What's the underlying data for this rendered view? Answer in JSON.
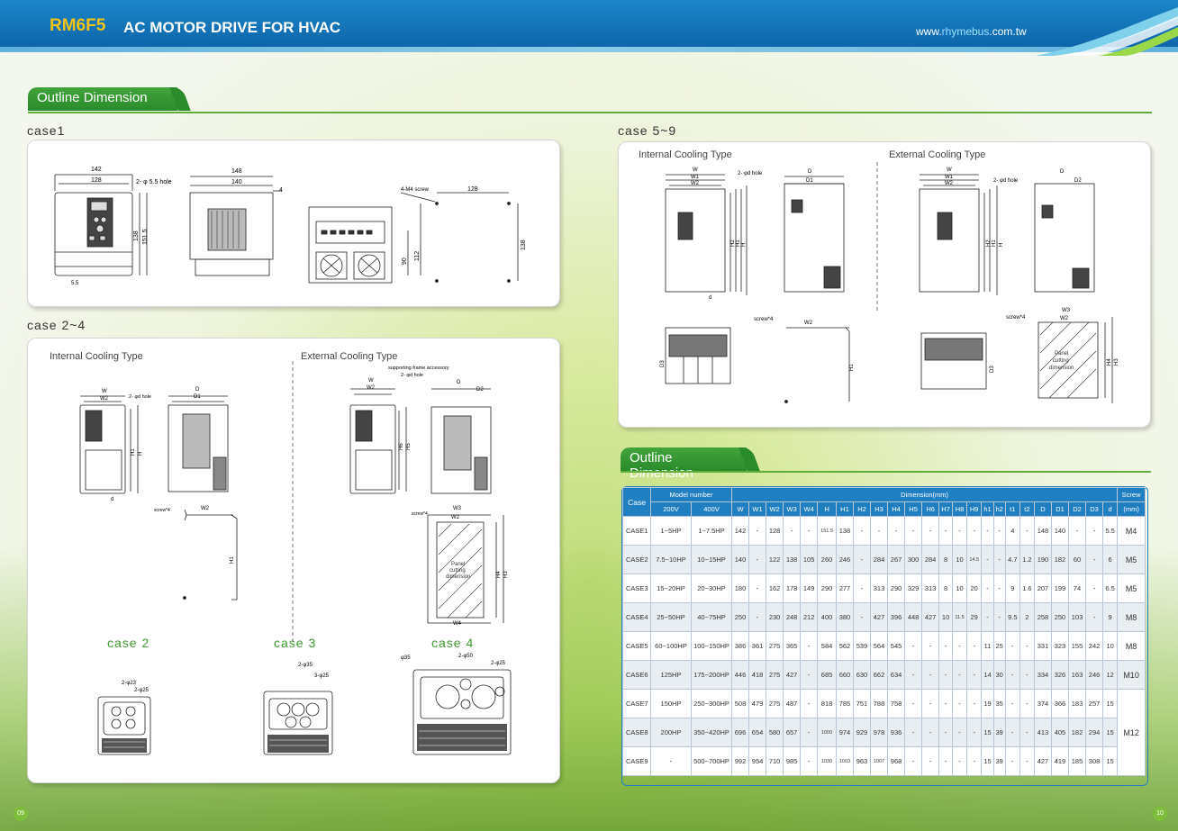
{
  "header": {
    "brand": "RM6F5",
    "subtitle": "AC MOTOR DRIVE FOR HVAC",
    "url_pre": "www.",
    "url_hl": "rhymebus",
    "url_post": ".com.tw"
  },
  "section_title": "Outline Dimension",
  "table_title": "Outline Dimension",
  "case1": {
    "label": "case1",
    "d142": "142",
    "d128": "128",
    "hole": "2- φ 5.5 hole",
    "d148": "148",
    "d140": "140",
    "d4": "4",
    "screw": "4-M4 screw",
    "d128b": "128",
    "d138": "138",
    "d90": "90",
    "d112": "112",
    "d5_5": "5.5",
    "d138b": "138",
    "d151_5": "151.5"
  },
  "case24": {
    "label": "case 2~4",
    "internal": "Internal Cooling Type",
    "external": "External Cooling Type",
    "support": "supporting frame accessory",
    "adhole": "2- φd hole",
    "screw": "screw*4",
    "panel": [
      "Panel",
      "cutting",
      "dimension"
    ],
    "case2": "case 2",
    "case3": "case 3",
    "case4": "case 4",
    "c2a": "2-φ23",
    "c2b": "2-φ25",
    "c3a": "2-φ35",
    "c3b": "3-φ25",
    "c4a": "φ35",
    "c4b": "2-φ50",
    "c4c": "2-φ25",
    "W": "W",
    "W1": "W1",
    "W2": "W2",
    "W3": "W3",
    "W4": "W4",
    "D": "D",
    "D1": "D1",
    "D2": "D2",
    "H": "H",
    "H1": "H1",
    "H3": "H3",
    "H4": "H4",
    "H5": "H5",
    "H6": "H6",
    "d": "d",
    "t1": "t1",
    "t2": "t2",
    "h1": "h1",
    "h2": "h2"
  },
  "case59": {
    "label": "case 5~9",
    "internal": "Internal Cooling Type",
    "external": "External Cooling Type",
    "adhole": "2- φd hole",
    "screw": "screw*4",
    "panel": [
      "Panel",
      "cutting",
      "dimension"
    ],
    "W": "W",
    "W1": "W1",
    "W2": "W2",
    "W3": "W3",
    "D": "D",
    "D1": "D1",
    "D2": "D2",
    "D3": "D3",
    "H": "H",
    "H1": "H1",
    "H2": "H2",
    "H3": "H3",
    "H4": "H4",
    "h1": "h1",
    "h2": "h2",
    "d": "d"
  },
  "table": {
    "col_case": "Case",
    "col_model": "Model number",
    "col_dim": "Dimension(mm)",
    "col_screw": "Screw",
    "sub_200": "200V",
    "sub_400": "400V",
    "sub_mm": "(mm)",
    "dims": [
      "W",
      "W1",
      "W2",
      "W3",
      "W4",
      "H",
      "H1",
      "H2",
      "H3",
      "H4",
      "H5",
      "H6",
      "H7",
      "H8",
      "H9",
      "h1",
      "h2",
      "t1",
      "t2",
      "D",
      "D1",
      "D2",
      "D3",
      "d"
    ],
    "rows": [
      {
        "case": "CASE1",
        "v200": "1~5HP",
        "v400": "1~7.5HP",
        "vals": [
          "142",
          "-",
          "128",
          "-",
          "-",
          "151.5",
          "138",
          "-",
          "-",
          "-",
          "-",
          "-",
          "-",
          "-",
          "-",
          "-",
          "-",
          "4",
          "-",
          "148",
          "140",
          "-",
          "-",
          "5.5"
        ],
        "screw": "M4"
      },
      {
        "case": "CASE2",
        "v200": "7.5~10HP",
        "v400": "10~15HP",
        "vals": [
          "140",
          "-",
          "122",
          "138",
          "105",
          "260",
          "246",
          "-",
          "284",
          "267",
          "300",
          "284",
          "8",
          "10",
          "14.5",
          "-",
          "-",
          "4.7",
          "1.2",
          "190",
          "182",
          "60",
          "-",
          "6"
        ],
        "screw": "M5"
      },
      {
        "case": "CASE3",
        "v200": "15~20HP",
        "v400": "20~30HP",
        "vals": [
          "180",
          "-",
          "162",
          "178",
          "149",
          "290",
          "277",
          "-",
          "313",
          "290",
          "329",
          "313",
          "8",
          "10",
          "20",
          "-",
          "-",
          "9",
          "1.6",
          "207",
          "199",
          "74",
          "-",
          "6.5"
        ],
        "screw": "M5"
      },
      {
        "case": "CASE4",
        "v200": "25~50HP",
        "v400": "40~75HP",
        "vals": [
          "250",
          "-",
          "230",
          "248",
          "212",
          "400",
          "380",
          "-",
          "427",
          "396",
          "448",
          "427",
          "10",
          "11.5",
          "29",
          "-",
          "-",
          "9.5",
          "2",
          "258",
          "250",
          "103",
          "-",
          "9"
        ],
        "screw": "M8"
      },
      {
        "case": "CASE5",
        "v200": "60~100HP",
        "v400": "100~150HP",
        "vals": [
          "386",
          "361",
          "275",
          "365",
          "-",
          "584",
          "562",
          "539",
          "564",
          "545",
          "-",
          "-",
          "-",
          "-",
          "-",
          "11",
          "25",
          "-",
          "-",
          "331",
          "323",
          "155",
          "242",
          "10"
        ],
        "screw": "M8"
      },
      {
        "case": "CASE6",
        "v200": "125HP",
        "v400": "175~200HP",
        "vals": [
          "446",
          "418",
          "275",
          "427",
          "-",
          "685",
          "660",
          "630",
          "662",
          "634",
          "-",
          "-",
          "-",
          "-",
          "-",
          "14",
          "30",
          "-",
          "-",
          "334",
          "326",
          "163",
          "246",
          "12"
        ],
        "screw": "M10"
      },
      {
        "case": "CASE7",
        "v200": "150HP",
        "v400": "250~300HP",
        "vals": [
          "508",
          "479",
          "275",
          "487",
          "-",
          "818",
          "785",
          "751",
          "788",
          "758",
          "-",
          "-",
          "-",
          "-",
          "-",
          "19",
          "35",
          "-",
          "-",
          "374",
          "366",
          "183",
          "257",
          "15"
        ],
        "screw": ""
      },
      {
        "case": "CASE8",
        "v200": "200HP",
        "v400": "350~420HP",
        "vals": [
          "696",
          "654",
          "580",
          "657",
          "-",
          "1000",
          "974",
          "929",
          "978",
          "936",
          "-",
          "-",
          "-",
          "-",
          "-",
          "15",
          "39",
          "-",
          "-",
          "413",
          "405",
          "182",
          "294",
          "15"
        ],
        "screw": "M12"
      },
      {
        "case": "CASE9",
        "v200": "-",
        "v400": "500~700HP",
        "vals": [
          "992",
          "954",
          "710",
          "985",
          "-",
          "1030",
          "1003",
          "963",
          "1007",
          "968",
          "-",
          "-",
          "-",
          "-",
          "-",
          "15",
          "39",
          "-",
          "-",
          "427",
          "419",
          "185",
          "308",
          "15"
        ],
        "screw": ""
      }
    ]
  },
  "page_left": "09",
  "page_right": "10"
}
